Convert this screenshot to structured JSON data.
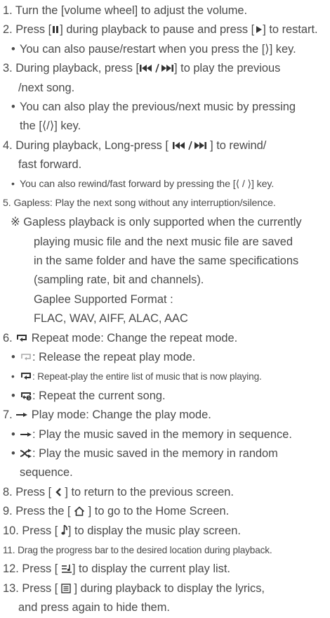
{
  "lines": [
    {
      "pre": "",
      "text": "1. Turn the [volume wheel] to adjust the volume."
    },
    {
      "pre": "2. Press [",
      "icon": "pause-icon",
      "mid": "] during playback to pause and press [",
      "icon2": "play-icon",
      "post": "] to restart."
    },
    {
      "pre": "You can also pause/restart when you press the [",
      "glyph": "⟩",
      "post": "] key."
    },
    {
      "pre": "3. During playback, press [",
      "icon": "prev-next-icon",
      "post": "] to play the previous"
    },
    {
      "text": "/next song."
    },
    {
      "pre": "You can also play the previous/next music by pressing"
    },
    {
      "pre": "the [",
      "glyph": "⟨/⟩",
      "post": "] key."
    },
    {
      "pre": "4. During playback, Long-press [ ",
      "icon": "prev-next-icon",
      "post": " ] to rewind/"
    },
    {
      "text": "fast forward."
    },
    {
      "pre": "You can also rewind/fast forward by pressing the [",
      "glyph": "⟨ / ⟩",
      "post": "] key."
    },
    {
      "text": "5. Gapless: Play the next song without any interruption/silence."
    },
    {
      "text": "※ Gapless playback is only supported when the currently"
    },
    {
      "text": "playing music file and the next music file are saved"
    },
    {
      "text": "in the same folder and have the same specifications"
    },
    {
      "text": "(sampling rate, bit and channels)."
    },
    {
      "text": "Gaplee Supported Format :"
    },
    {
      "text": "FLAC, WAV, AIFF, ALAC, AAC"
    },
    {
      "pre": "6. ",
      "icon": "repeat-icon",
      "post": " Repeat mode: Change the repeat mode."
    },
    {
      "icon": "repeat-off-icon",
      "post": ": Release the repeat play mode."
    },
    {
      "icon": "repeat-all-icon",
      "post": ": Repeat-play the entire list of music that is now playing."
    },
    {
      "icon": "repeat-one-icon",
      "post": ": Repeat the current song."
    },
    {
      "pre": "7. ",
      "icon": "sequence-icon",
      "post": " Play mode: Change the play mode."
    },
    {
      "icon": "sequence-icon",
      "post": ": Play the music saved in the memory in sequence."
    },
    {
      "icon": "shuffle-icon",
      "post": ": Play the music saved in the memory in random"
    },
    {
      "text": "sequence."
    },
    {
      "pre": "8. Press [ ",
      "icon": "back-icon",
      "post": " ] to return to the previous screen."
    },
    {
      "pre": "9. Press the [ ",
      "icon": "home-icon",
      "post": " ] to go to the Home Screen."
    },
    {
      "pre": "10. Press [ ",
      "icon": "music-note-icon",
      "post": "] to display the music play screen."
    },
    {
      "text": "11. Drag the progress bar to the desired location during playback."
    },
    {
      "pre": "12. Press [ ",
      "icon": "playlist-icon",
      "post": "] to display the current play list."
    },
    {
      "pre": "13. Press [ ",
      "icon": "lyrics-icon",
      "post": " ] during playback to display the lyrics,"
    },
    {
      "text": "and press again  to hide them."
    }
  ]
}
